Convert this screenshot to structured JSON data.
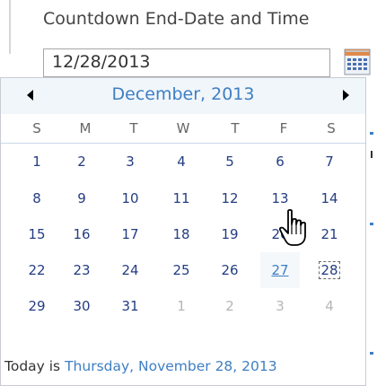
{
  "field": {
    "label": "Countdown End-Date and Time",
    "value": "12/28/2013"
  },
  "calendar": {
    "month_title": "December, 2013",
    "days_of_week": [
      "S",
      "M",
      "T",
      "W",
      "T",
      "F",
      "S"
    ],
    "weeks": [
      [
        "1",
        "2",
        "3",
        "4",
        "5",
        "6",
        "7"
      ],
      [
        "8",
        "9",
        "10",
        "11",
        "12",
        "13",
        "14"
      ],
      [
        "15",
        "16",
        "17",
        "18",
        "19",
        "20",
        "21"
      ],
      [
        "22",
        "23",
        "24",
        "25",
        "26",
        "27",
        "28"
      ],
      [
        "29",
        "30",
        "31",
        "1",
        "2",
        "3",
        "4"
      ]
    ],
    "footer_prefix": "Today is ",
    "footer_link": "Thursday, November 28, 2013"
  },
  "colors": {
    "accent": "#3e7fc3",
    "day_text": "#243d82",
    "other_month": "#b6b6b6"
  },
  "icons": {
    "calendar_button": "calendar-grid-icon",
    "cursor": "hand-pointer-icon"
  }
}
